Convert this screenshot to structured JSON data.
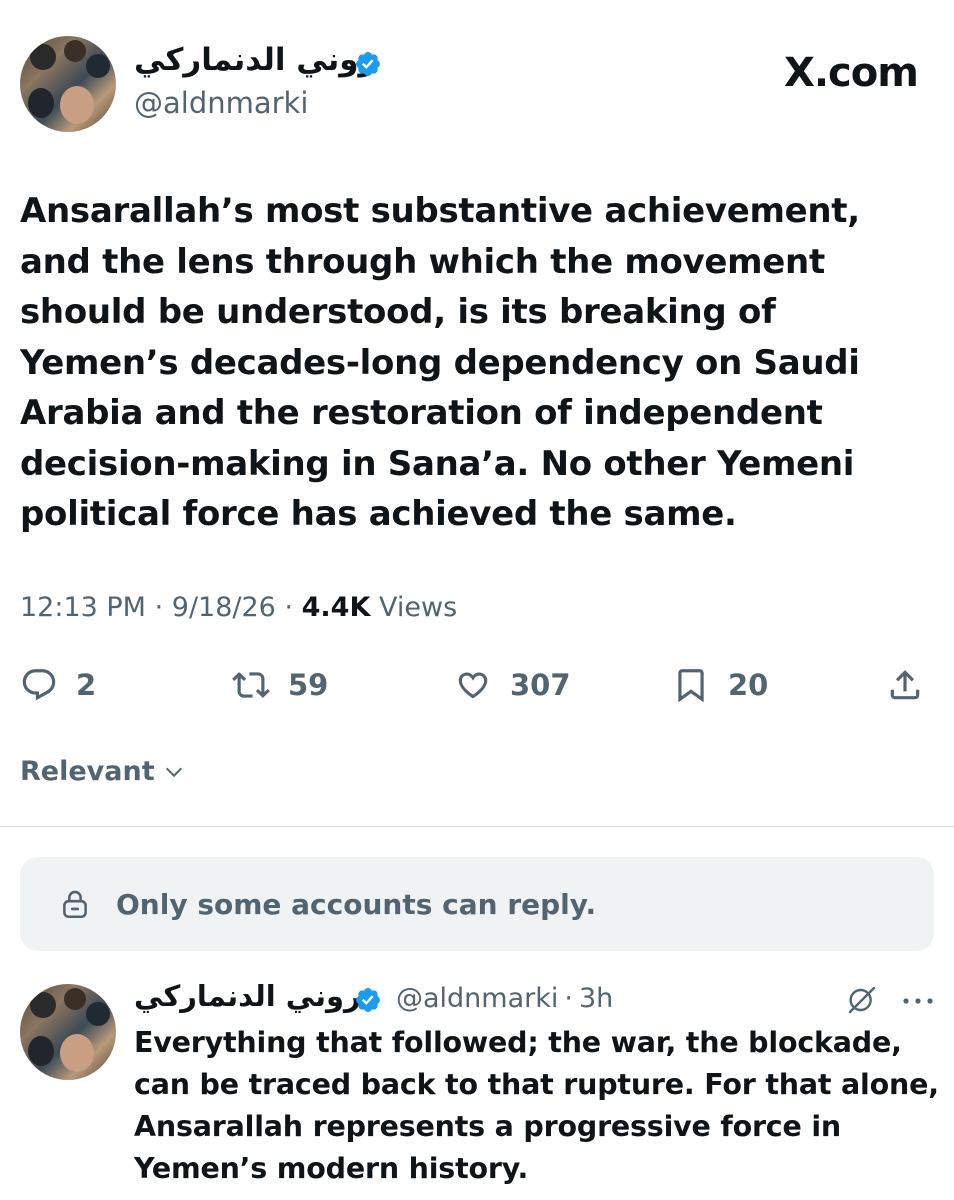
{
  "tweet": {
    "author_name": "روني الدنماركي",
    "author_handle": "@aldnmarki",
    "site_label": "X.com",
    "text": "Ansarallah’s most substantive achievement, and the lens through which the movement should be understood, is its breaking of Yemen’s decades-long dependency on Saudi Arabia and the restoration of independent decision-making in Sana’a. No other Yemeni political force has achieved the same.",
    "time": "12:13 PM",
    "date": "9/18/26",
    "views_count": "4.4K",
    "views_label": "Views",
    "dot_separator": "·"
  },
  "actions": {
    "replies": "2",
    "reposts": "59",
    "likes": "307",
    "bookmarks": "20"
  },
  "sort": {
    "label": "Relevant"
  },
  "reply_restriction": {
    "text": "Only some accounts can reply."
  },
  "reply": {
    "author_name": "روني الدنماركي",
    "author_handle": "@aldnmarki",
    "separator": "·",
    "time_ago": "3h",
    "text": "Everything that followed; the war, the blockade, can be traced back to that rupture. For that alone, Ansarallah represents a progressive force in Yemen’s modern history."
  },
  "colors": {
    "text_primary": "#0f1419",
    "text_secondary": "#536471",
    "verified_blue": "#1d9bf0",
    "restrict_bg": "#eff3f4",
    "divider": "#cfd9de"
  },
  "icons": {
    "verified": "verified-badge-icon",
    "reply": "speech-bubble-icon",
    "repost": "repost-arrows-icon",
    "like": "heart-icon",
    "bookmark": "bookmark-icon",
    "share": "share-upload-icon",
    "chevron": "chevron-down-icon",
    "lock": "lock-icon",
    "grok": "grok-icon",
    "more": "more-dots-icon"
  }
}
